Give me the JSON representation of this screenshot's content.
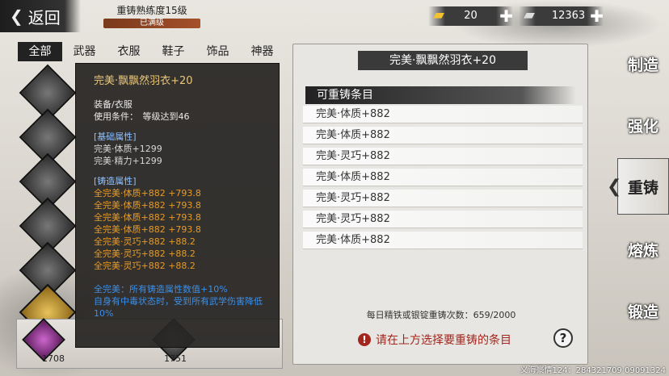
{
  "header": {
    "back_label": "返回",
    "mastery_title": "重铸熟练度15级",
    "mastery_status": "已满级"
  },
  "currency": {
    "gold_amount": "20",
    "silver_amount": "12363"
  },
  "tabs": [
    "全部",
    "武器",
    "衣服",
    "鞋子",
    "饰品",
    "神器"
  ],
  "right_nav": [
    "制造",
    "强化",
    "重铸",
    "熔炼",
    "锻造"
  ],
  "bottom_slots": {
    "slot1_count": "1708",
    "slot2_count": "1751"
  },
  "tooltip": {
    "title": "完美·飘飘然羽衣+20",
    "type": "装备/衣服",
    "use_condition": "使用条件：　等级达到46",
    "base_header": "[基础属性]",
    "base_attrs": [
      "完美·体质+1299",
      "完美·精力+1299"
    ],
    "forge_header": "[铸造属性]",
    "forge_attrs": [
      "全完美·体质+882 +793.8",
      "全完美·体质+882 +793.8",
      "全完美·体质+882 +793.8",
      "全完美·体质+882 +793.8",
      "全完美·灵巧+882 +88.2",
      "全完美·灵巧+882 +88.2",
      "全完美·灵巧+882 +88.2"
    ],
    "note_blue": "全完美：所有铸造属性数值+10%",
    "note_blue2": "自身有中毒状态时，受到所有武学伤害降低10%"
  },
  "panel": {
    "title": "完美·飘飘然羽衣+20",
    "list_header": "可重铸条目",
    "entries": [
      "完美·体质+882",
      "完美·体质+882",
      "完美·灵巧+882",
      "完美·体质+882",
      "完美·灵巧+882",
      "完美·灵巧+882",
      "完美·体质+882"
    ],
    "daily_count": "每日精铁或银锭重铸次数：659/2000",
    "warning": "请在上方选择要重铸的条目",
    "help": "?"
  },
  "footer": "义海豪情124：284321709 09091324",
  "colors": {
    "accent_red": "#a3261e",
    "forge_orange": "#e89a25",
    "note_blue": "#3a8fe8"
  }
}
